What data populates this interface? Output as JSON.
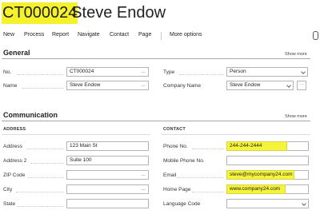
{
  "header": {
    "record_no": "CT000024",
    "separator_name": "· Steve Endow"
  },
  "actions": [
    "New",
    "Process",
    "Report",
    "Navigate",
    "Contact",
    "Page",
    "More options"
  ],
  "general": {
    "title": "General",
    "show_more": "Show more",
    "fields": {
      "no": {
        "label": "No.",
        "value": "CT000024"
      },
      "name": {
        "label": "Name",
        "value": "Steve Endow"
      },
      "type": {
        "label": "Type",
        "value": "Person"
      },
      "company_name": {
        "label": "Company Name",
        "value": "Steve Endow"
      }
    }
  },
  "communication": {
    "title": "Communication",
    "show_more": "Show more",
    "address_head": "ADDRESS",
    "contact_head": "CONTACT",
    "address": {
      "address": {
        "label": "Address",
        "value": "123 Main St"
      },
      "address2": {
        "label": "Address 2",
        "value": "Suite 100"
      },
      "zip": {
        "label": "ZIP Code",
        "value": ""
      },
      "city": {
        "label": "City",
        "value": ""
      },
      "state": {
        "label": "State",
        "value": ""
      }
    },
    "contact": {
      "phone": {
        "label": "Phone No.",
        "value": "244-244-2444"
      },
      "mobile": {
        "label": "Mobile Phone No.",
        "value": ""
      },
      "email": {
        "label": "Email",
        "value": "steve@mycompany24.com"
      },
      "home": {
        "label": "Home Page",
        "value": "www.company24.com"
      },
      "language": {
        "label": "Language Code",
        "value": ""
      }
    }
  },
  "icons": {
    "ellipsis": "...",
    "side_ellipsis": "···"
  },
  "colors": {
    "highlight": "#f6f43a"
  }
}
